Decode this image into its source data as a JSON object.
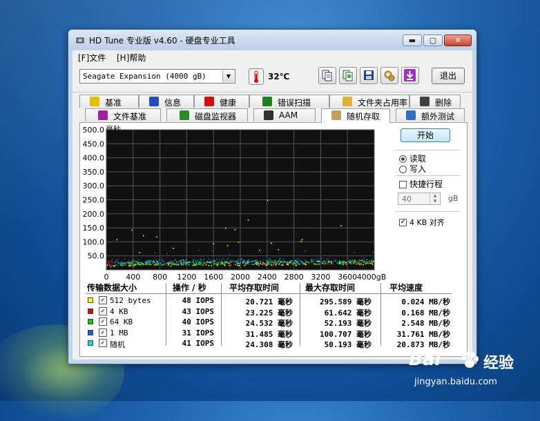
{
  "window": {
    "title": "HD Tune 专业版 v4.60 - 硬盘专业工具",
    "controls": {
      "minimize": "▬",
      "maximize": "▢",
      "close": "✕"
    }
  },
  "menu": {
    "file": "[F]文件",
    "help": "[H]帮助"
  },
  "toolbar": {
    "drive": "Seagate Expansion       (4000 gB)",
    "temperature": "32℃",
    "exit": "退出"
  },
  "tabs_row1": [
    "基准",
    "信息",
    "健康",
    "错误扫描",
    "文件夹占用率",
    "删除"
  ],
  "tabs_row2": [
    "文件基准",
    "磁盘监视器",
    "AAM",
    "随机存取",
    "额外测试"
  ],
  "active_tab": "随机存取",
  "chart": {
    "y_unit": "毫秒"
  },
  "side": {
    "start": "开始",
    "read": "读取",
    "write": "写入",
    "quick_label": "快捷行程",
    "quick_value": "40",
    "quick_unit": "gB",
    "align_label": "4 KB 对齐"
  },
  "results": {
    "headers": [
      "传输数据大小",
      "操作 / 秒",
      "平均存取时间",
      "最大存取时间",
      "平均速度"
    ],
    "rows": [
      {
        "name": "512 bytes",
        "color": "#ffff00",
        "ops": "48 IOPS",
        "avg": "20.721 毫秒",
        "max": "295.589 毫秒",
        "speed": "0.024 MB/秒"
      },
      {
        "name": "4 KB",
        "color": "#e00000",
        "ops": "43 IOPS",
        "avg": "23.225 毫秒",
        "max": "61.642 毫秒",
        "speed": "0.168 MB/秒"
      },
      {
        "name": "64 KB",
        "color": "#00d000",
        "ops": "40 IOPS",
        "avg": "24.532 毫秒",
        "max": "52.193 毫秒",
        "speed": "2.548 MB/秒"
      },
      {
        "name": "1 MB",
        "color": "#1060e0",
        "ops": "31 IOPS",
        "avg": "31.485 毫秒",
        "max": "100.707 毫秒",
        "speed": "31.761 MB/秒"
      },
      {
        "name": "随机",
        "color": "#00e0e0",
        "ops": "41 IOPS",
        "avg": "24.308 毫秒",
        "max": "50.193 毫秒",
        "speed": "20.873 MB/秒"
      }
    ]
  },
  "chart_data": {
    "type": "scatter",
    "ylabel": "毫秒",
    "xlabel": "",
    "ylim": [
      0,
      500
    ],
    "xlim": [
      0,
      4000
    ],
    "yticks": [
      "500.0",
      "450.0",
      "400.0",
      "350.0",
      "300.0",
      "250.0",
      "200.0",
      "150.0",
      "100.0",
      "50.0"
    ],
    "xticks": [
      "0",
      "400",
      "800",
      "1200",
      "1600",
      "2000",
      "2400",
      "2800",
      "3200",
      "3600",
      "4000gB"
    ],
    "series": [
      {
        "name": "512 bytes",
        "color": "#ffff00",
        "typical_ms": 20.7,
        "max_ms": 295.6
      },
      {
        "name": "4 KB",
        "color": "#e00000",
        "typical_ms": 23.2,
        "max_ms": 61.6
      },
      {
        "name": "64 KB",
        "color": "#00d000",
        "typical_ms": 24.5,
        "max_ms": 52.2
      },
      {
        "name": "1 MB",
        "color": "#1060e0",
        "typical_ms": 31.5,
        "max_ms": 100.7
      },
      {
        "name": "随机",
        "color": "#00e0e0",
        "typical_ms": 24.3,
        "max_ms": 50.2
      }
    ],
    "grid": true
  },
  "watermark": {
    "logo": "Bai",
    "brand": "经验",
    "url": "jingyan.baidu.com"
  }
}
